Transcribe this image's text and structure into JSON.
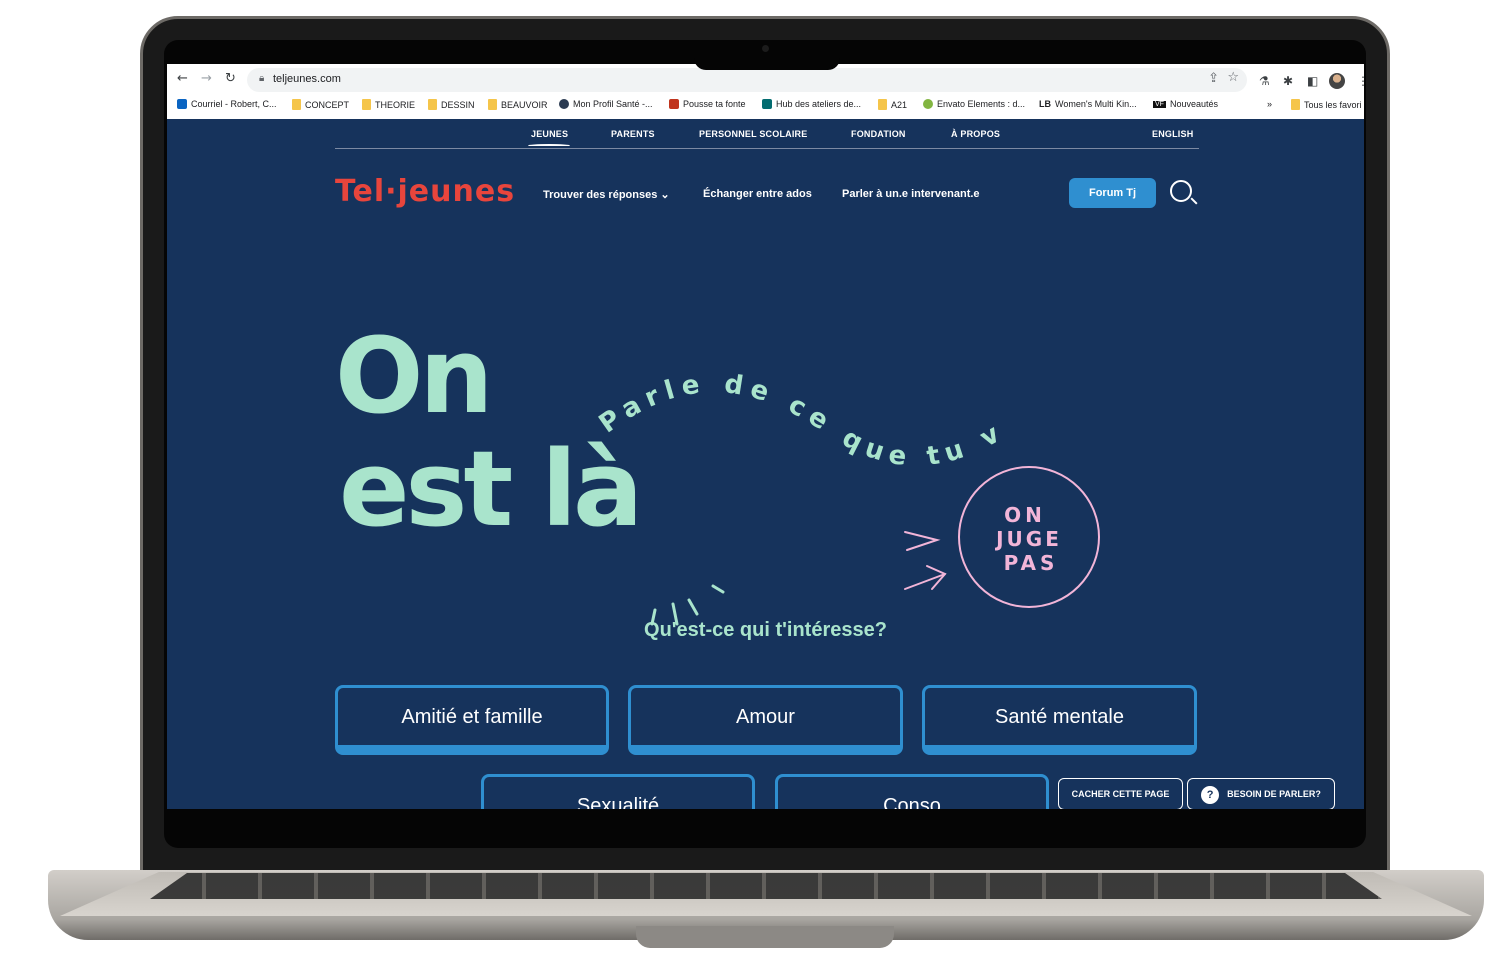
{
  "browser": {
    "url": "teljeunes.com",
    "bookmarks": [
      {
        "label": "Courriel - Robert, C...",
        "icon": "outlook-icon"
      },
      {
        "label": "CONCEPT",
        "icon": "folder-icon"
      },
      {
        "label": "THEORIE",
        "icon": "folder-icon"
      },
      {
        "label": "DESSIN",
        "icon": "folder-icon"
      },
      {
        "label": "BEAUVOIR",
        "icon": "folder-icon"
      },
      {
        "label": "Mon Profil Santé -...",
        "icon": "profile-icon"
      },
      {
        "label": "Pousse ta fonte",
        "icon": "font-icon"
      },
      {
        "label": "Hub des ateliers de...",
        "icon": "sharepoint-icon"
      },
      {
        "label": "A21",
        "icon": "folder-icon"
      },
      {
        "label": "Envato Elements : d...",
        "icon": "envato-icon"
      },
      {
        "label": "Women's Multi Kin...",
        "icon": "lb-icon",
        "prefix": "LB"
      },
      {
        "label": "Nouveautés",
        "icon": "vf-icon",
        "prefix": "VF"
      },
      {
        "label": "»",
        "icon": ""
      },
      {
        "label": "Tous les favori",
        "icon": "folder-icon"
      }
    ]
  },
  "site": {
    "topnav": [
      "JEUNES",
      "PARENTS",
      "PERSONNEL SCOLAIRE",
      "FONDATION",
      "À PROPOS"
    ],
    "english": "ENGLISH",
    "logo": "Tel·jeunes",
    "mainnav": [
      "Trouver des réponses",
      "Échanger entre ados",
      "Parler à un.e intervenant.e"
    ],
    "forum_button": "Forum Tj",
    "hero": {
      "line1": "On",
      "line2": "est là",
      "curved_text": "Parle de ce que tu veux.",
      "badge_lines": [
        "ON",
        "JUGE",
        "PAS"
      ]
    },
    "interest_prompt": "Qu'est-ce qui t'intéresse?",
    "categories": [
      "Amitié et famille",
      "Amour",
      "Santé mentale",
      "Sexualité",
      "Conso"
    ],
    "hide_page": "CACHER CETTE PAGE",
    "need_talk": "BESOIN DE PARLER?",
    "colors": {
      "navy": "#16335c",
      "mint": "#a9e4cc",
      "brand_red": "#e8453c",
      "blue": "#2f8fd0",
      "pink": "#f2b5d8"
    }
  }
}
